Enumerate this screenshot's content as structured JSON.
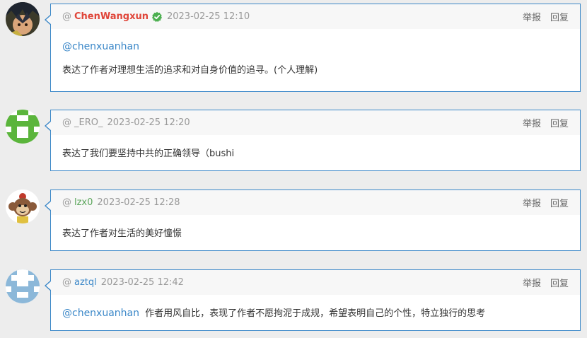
{
  "actions": {
    "report": "举报",
    "reply": "回复"
  },
  "at_sign": "@",
  "comments": [
    {
      "username": "ChenWangxun",
      "verified": true,
      "time": "2023-02-25 12:10",
      "mention": "@chenxuanhan",
      "text": "表达了作者对理想生活的追求和对自身价值的追寻。(个人理解)"
    },
    {
      "username": "_ERO_",
      "verified": false,
      "time": "2023-02-25 12:20",
      "text": "表达了我们要坚持中共的正确领导（bushi"
    },
    {
      "username": "lzx0",
      "verified": false,
      "time": "2023-02-25 12:28",
      "text": "表达了作者对生活的美好憧憬"
    },
    {
      "username": "aztql",
      "verified": false,
      "time": "2023-02-25 12:42",
      "mention": "@chenxuanhan",
      "text": "作者用风自比，表现了作者不愿拘泥于成规，希望表明自己的个性，特立独行的思考"
    }
  ]
}
